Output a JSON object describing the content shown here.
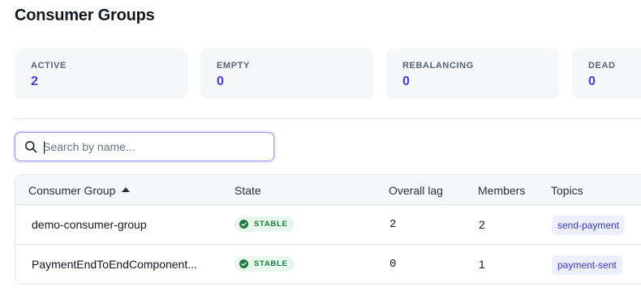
{
  "page": {
    "title": "Consumer Groups"
  },
  "stats": [
    {
      "label": "ACTIVE",
      "value": "2"
    },
    {
      "label": "EMPTY",
      "value": "0"
    },
    {
      "label": "REBALANCING",
      "value": "0"
    },
    {
      "label": "DEAD",
      "value": "0"
    }
  ],
  "search": {
    "placeholder": "Search by name...",
    "value": ""
  },
  "table": {
    "columns": [
      "Consumer Group",
      "State",
      "Overall lag",
      "Members",
      "Topics"
    ],
    "sort": {
      "column": "Consumer Group",
      "direction": "ascending"
    },
    "rows": [
      {
        "name": "demo-consumer-group",
        "state": "STABLE",
        "lag": "2",
        "members": "2",
        "topic": "send-payment"
      },
      {
        "name": "PaymentEndToEndComponent...",
        "state": "STABLE",
        "lag": "0",
        "members": "1",
        "topic": "payment-sent"
      }
    ]
  },
  "icons": {
    "search": "search-icon",
    "sort": "sort-ascending-icon",
    "state": "check-circle-icon"
  },
  "colors": {
    "accent": "#3d3fd8",
    "stable_badge_bg": "#e9f6ee",
    "stable_badge_fg": "#1f7a41",
    "topic_tag_bg": "#eeeffd",
    "topic_tag_fg": "#3636c8"
  }
}
